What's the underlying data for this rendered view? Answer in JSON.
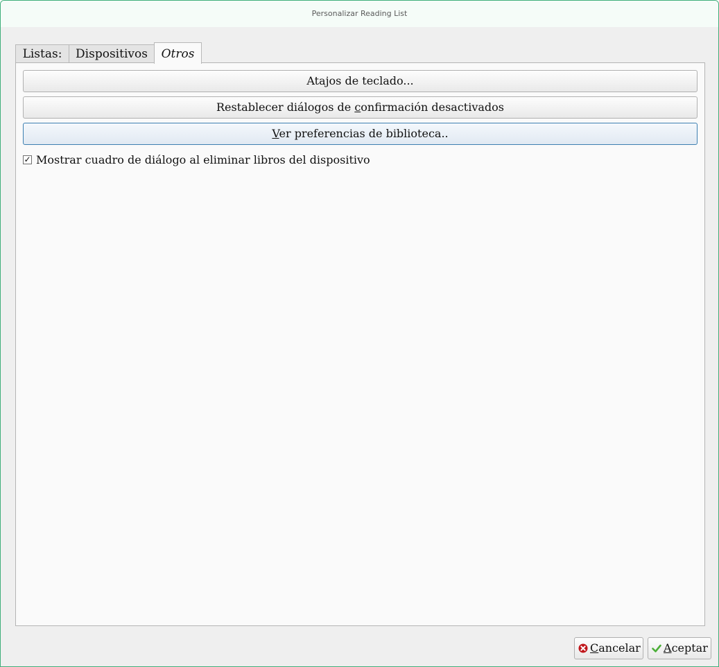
{
  "window": {
    "title": "Personalizar Reading List"
  },
  "tabs": [
    {
      "label": "Listas:",
      "active": false
    },
    {
      "label": "Dispositivos",
      "active": false
    },
    {
      "label": "Otros",
      "active": true
    }
  ],
  "panel": {
    "buttons": {
      "keyboard_shortcuts": {
        "label": "Atajos de teclado..."
      },
      "reset_confirmations": {
        "label_pre": "Restablecer diálogos de ",
        "mnemonic": "c",
        "label_post": "onfirmación desactivados"
      },
      "library_prefs": {
        "mnemonic": "V",
        "label_post": "er preferencias de biblioteca.."
      }
    },
    "checkbox": {
      "label": "Mostrar cuadro de diálogo al eliminar libros del dispositivo",
      "checked": true,
      "mark": "✓"
    }
  },
  "footer": {
    "cancel": {
      "mnemonic": "C",
      "label_post": "ancelar",
      "icon": "cancel-icon"
    },
    "accept": {
      "mnemonic": "A",
      "label_post": "ceptar",
      "icon": "checkmark-icon"
    }
  },
  "colors": {
    "window_border": "#3fae7a",
    "cancel_icon": "#c0161b",
    "accept_icon": "#4caf38",
    "focus_border": "#3c7fb1"
  }
}
